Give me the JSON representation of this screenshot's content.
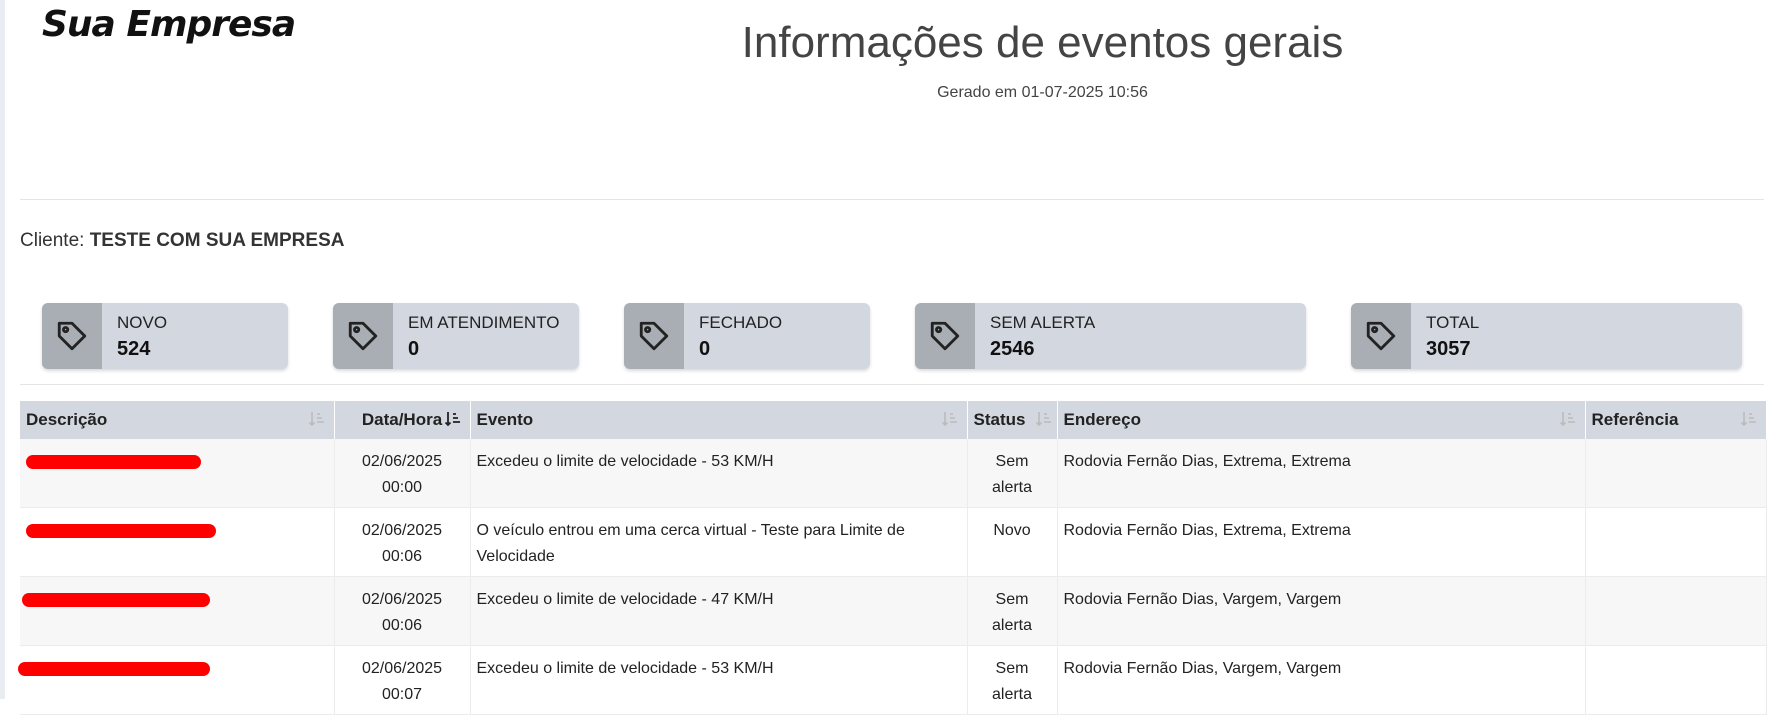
{
  "brand": {
    "logo_text": "Sua Empresa"
  },
  "report": {
    "title": "Informações de eventos gerais",
    "generated": "Gerado em 01-07-2025 10:56"
  },
  "client": {
    "label": "Cliente:",
    "name": "TESTE COM SUA EMPRESA"
  },
  "cards": [
    {
      "icon": "tag-icon",
      "label": "NOVO",
      "value": "524"
    },
    {
      "icon": "tag-icon",
      "label": "EM ATENDIMENTO",
      "value": "0"
    },
    {
      "icon": "tag-icon",
      "label": "FECHADO",
      "value": "0"
    },
    {
      "icon": "tag-icon",
      "label": "SEM ALERTA",
      "value": "2546"
    },
    {
      "icon": "tag-icon",
      "label": "TOTAL",
      "value": "3057"
    }
  ],
  "table": {
    "columns": [
      "Descrição",
      "Data/Hora",
      "Evento",
      "Status",
      "Endereço",
      "Referência"
    ],
    "rows": [
      {
        "date": "02/06/2025",
        "time": "00:00",
        "evento": "Excedeu o limite de velocidade - 53 KM/H",
        "status": "Sem alerta",
        "endereco": "Rodovia Fernão Dias, Extrema, Extrema",
        "referencia": ""
      },
      {
        "date": "02/06/2025",
        "time": "00:06",
        "evento": "O veículo entrou em uma cerca virtual - Teste para Limite de Velocidade",
        "status": "Novo",
        "endereco": "Rodovia Fernão Dias, Extrema, Extrema",
        "referencia": ""
      },
      {
        "date": "02/06/2025",
        "time": "00:06",
        "evento": "Excedeu o limite de velocidade - 47 KM/H",
        "status": "Sem alerta",
        "endereco": "Rodovia Fernão Dias, Vargem, Vargem",
        "referencia": ""
      },
      {
        "date": "02/06/2025",
        "time": "00:07",
        "evento": "Excedeu o limite de velocidade - 53 KM/H",
        "status": "Sem alerta",
        "endereco": "Rodovia Fernão Dias, Vargem, Vargem",
        "referencia": ""
      }
    ]
  },
  "colors": {
    "card_bg": "#d3d8e0",
    "icon_box": "#a9adb4",
    "redaction": "#ff0000"
  }
}
